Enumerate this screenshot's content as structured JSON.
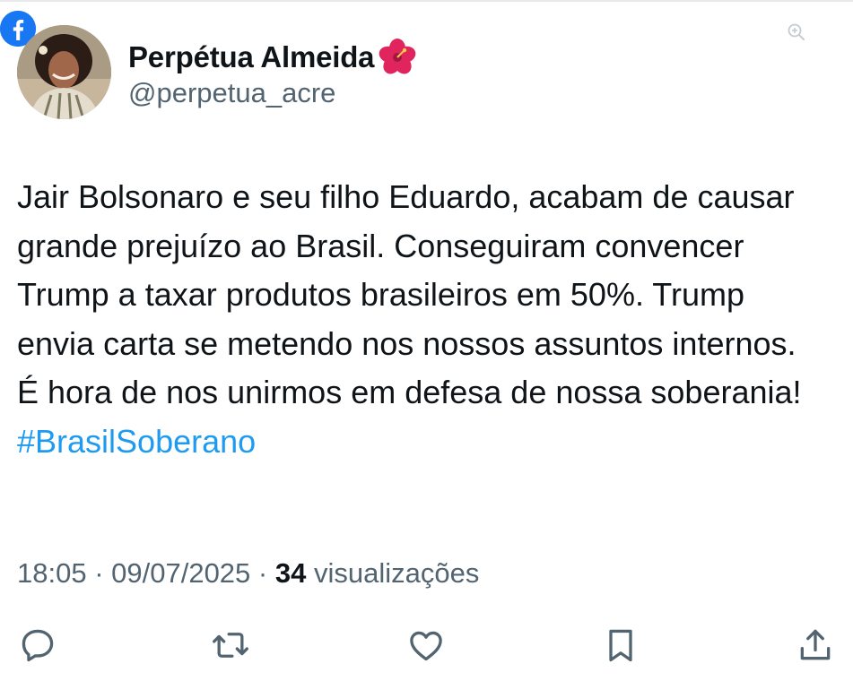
{
  "author": {
    "display_name": "Perpétua Almeida",
    "name_emoji": "hibiscus-emoji",
    "handle": "@perpetua_acre"
  },
  "tweet": {
    "text": "Jair Bolsonaro e seu filho Eduardo, acabam de causar grande prejuízo ao Brasil. Conseguiram convencer Trump a taxar produtos brasileiros em 50%. Trump envia carta se metendo nos nossos assuntos internos. É hora de nos unirmos em defesa de nossa soberania!",
    "hashtag": "#BrasilSoberano"
  },
  "meta": {
    "time": "18:05",
    "sep1": " · ",
    "date": "09/07/2025",
    "sep2": " · ",
    "views_count": "34",
    "views_label": " visualizações"
  },
  "icons": {
    "badge": "facebook-icon",
    "zoom": "zoom-in-icon",
    "reply": "reply-icon",
    "retweet": "retweet-icon",
    "like": "like-icon",
    "bookmark": "bookmark-icon",
    "share": "share-icon"
  },
  "colors": {
    "link": "#1d9bf0",
    "secondary_text": "#536471",
    "primary_text": "#0f1419",
    "facebook_blue": "#1877f2"
  }
}
